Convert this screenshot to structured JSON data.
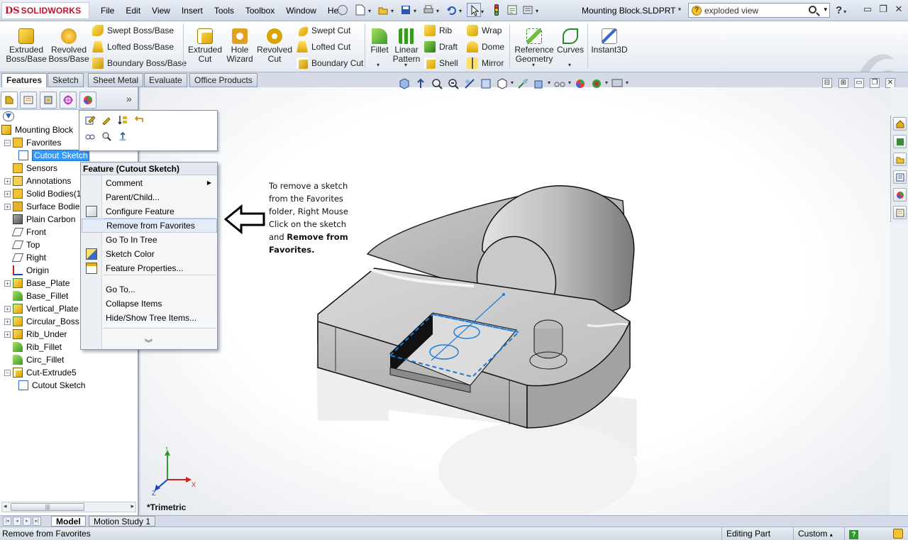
{
  "app": {
    "logo_ds": "DS",
    "logo_text": "SOLIDWORKS",
    "document_title": "Mounting Block.SLDPRT *"
  },
  "menu": [
    "File",
    "Edit",
    "View",
    "Insert",
    "Tools",
    "Toolbox",
    "Window",
    "Help"
  ],
  "search": {
    "value": "exploded view",
    "placeholder": "exploded view"
  },
  "window_buttons": {
    "minimize": "▭",
    "restore": "❐",
    "close": "✕"
  },
  "commands": {
    "extruded_boss": "Extruded\nBoss/Base",
    "revolved_boss": "Revolved\nBoss/Base",
    "swept_boss": "Swept Boss/Base",
    "lofted_boss": "Lofted Boss/Base",
    "boundary_boss": "Boundary Boss/Base",
    "extruded_cut": "Extruded\nCut",
    "hole_wizard": "Hole\nWizard",
    "revolved_cut": "Revolved\nCut",
    "swept_cut": "Swept Cut",
    "lofted_cut": "Lofted Cut",
    "boundary_cut": "Boundary Cut",
    "fillet": "Fillet",
    "linear_pattern": "Linear\nPattern",
    "rib": "Rib",
    "draft": "Draft",
    "shell": "Shell",
    "wrap": "Wrap",
    "dome": "Dome",
    "mirror": "Mirror",
    "reference_geometry": "Reference\nGeometry",
    "curves": "Curves",
    "instant3d": "Instant3D"
  },
  "tabs": [
    "Features",
    "Sketch",
    "Sheet Metal",
    "Evaluate",
    "Office Products"
  ],
  "tree": [
    {
      "label": "Mounting Block",
      "icon": "part-icon",
      "level": 0,
      "expand": ""
    },
    {
      "label": "Favorites",
      "icon": "favorites-folder-icon",
      "level": 1,
      "expand": "−"
    },
    {
      "label": "Cutout Sketch",
      "icon": "sketch-icon",
      "level": 2,
      "expand": "",
      "selected": true
    },
    {
      "label": "Sensors",
      "icon": "sensor-folder-icon",
      "level": 1,
      "expand": ""
    },
    {
      "label": "Annotations",
      "icon": "annotation-icon",
      "level": 1,
      "expand": "+"
    },
    {
      "label": "Solid Bodies(1",
      "icon": "solid-bodies-icon",
      "level": 1,
      "expand": "+"
    },
    {
      "label": "Surface Bodie",
      "icon": "surface-bodies-icon",
      "level": 1,
      "expand": "+"
    },
    {
      "label": "Plain Carbon",
      "icon": "material-icon",
      "level": 1,
      "expand": ""
    },
    {
      "label": "Front",
      "icon": "plane-icon",
      "level": 1,
      "expand": ""
    },
    {
      "label": "Top",
      "icon": "plane-icon",
      "level": 1,
      "expand": ""
    },
    {
      "label": "Right",
      "icon": "plane-icon",
      "level": 1,
      "expand": ""
    },
    {
      "label": "Origin",
      "icon": "origin-icon",
      "level": 1,
      "expand": ""
    },
    {
      "label": "Base_Plate",
      "icon": "extrude-feature-icon",
      "level": 1,
      "expand": "+"
    },
    {
      "label": "Base_Fillet",
      "icon": "fillet-feature-icon",
      "level": 1,
      "expand": ""
    },
    {
      "label": "Vertical_Plate",
      "icon": "extrude-feature-icon",
      "level": 1,
      "expand": "+"
    },
    {
      "label": "Circular_Boss",
      "icon": "extrude-feature-icon",
      "level": 1,
      "expand": "+"
    },
    {
      "label": "Rib_Under",
      "icon": "rib-feature-icon",
      "level": 1,
      "expand": "+"
    },
    {
      "label": "Rib_Fillet",
      "icon": "fillet-feature-icon",
      "level": 1,
      "expand": ""
    },
    {
      "label": "Circ_Fillet",
      "icon": "fillet-feature-icon",
      "level": 1,
      "expand": ""
    },
    {
      "label": "Cut-Extrude5",
      "icon": "cut-feature-icon",
      "level": 1,
      "expand": "−"
    },
    {
      "label": "Cutout Sketch",
      "icon": "sketch-icon",
      "level": 2,
      "expand": ""
    }
  ],
  "context_menu": {
    "title": "Feature (Cutout Sketch)",
    "items": [
      {
        "label": "Comment",
        "submenu": true,
        "icon": ""
      },
      {
        "label": "Parent/Child...",
        "icon": ""
      },
      {
        "label": "Configure Feature",
        "icon": "configure-feature-icon"
      },
      {
        "label": "Remove from Favorites",
        "icon": "",
        "highlight": true
      },
      {
        "label": "Go To In Tree",
        "icon": ""
      },
      {
        "label": "Sketch Color",
        "icon": "sketch-color-icon"
      },
      {
        "label": "Feature Properties...",
        "icon": "feature-properties-icon"
      },
      {
        "label": "Go To...",
        "icon": ""
      },
      {
        "label": "Collapse Items",
        "icon": ""
      },
      {
        "label": "Hide/Show Tree Items...",
        "icon": ""
      }
    ],
    "more": "»"
  },
  "annotation": {
    "line1": "To remove a sketch",
    "line2": "from the Favorites",
    "line3": "folder, Right Mouse",
    "line4": "Click on the sketch",
    "line5a": "and ",
    "line5b": "Remove from",
    "line6": "Favorites."
  },
  "viewport": {
    "view_name": "*Trimetric",
    "axis_x": "X",
    "axis_y": "Y",
    "axis_z": "Z"
  },
  "bottom_tabs": [
    "Model",
    "Motion Study 1"
  ],
  "status": {
    "message": "Remove from Favorites",
    "mode": "Editing Part",
    "units": "Custom"
  },
  "colors": {
    "accent_red": "#c8102e",
    "selection_blue": "#3399ff",
    "sketch_blue": "#1e7ad8"
  }
}
